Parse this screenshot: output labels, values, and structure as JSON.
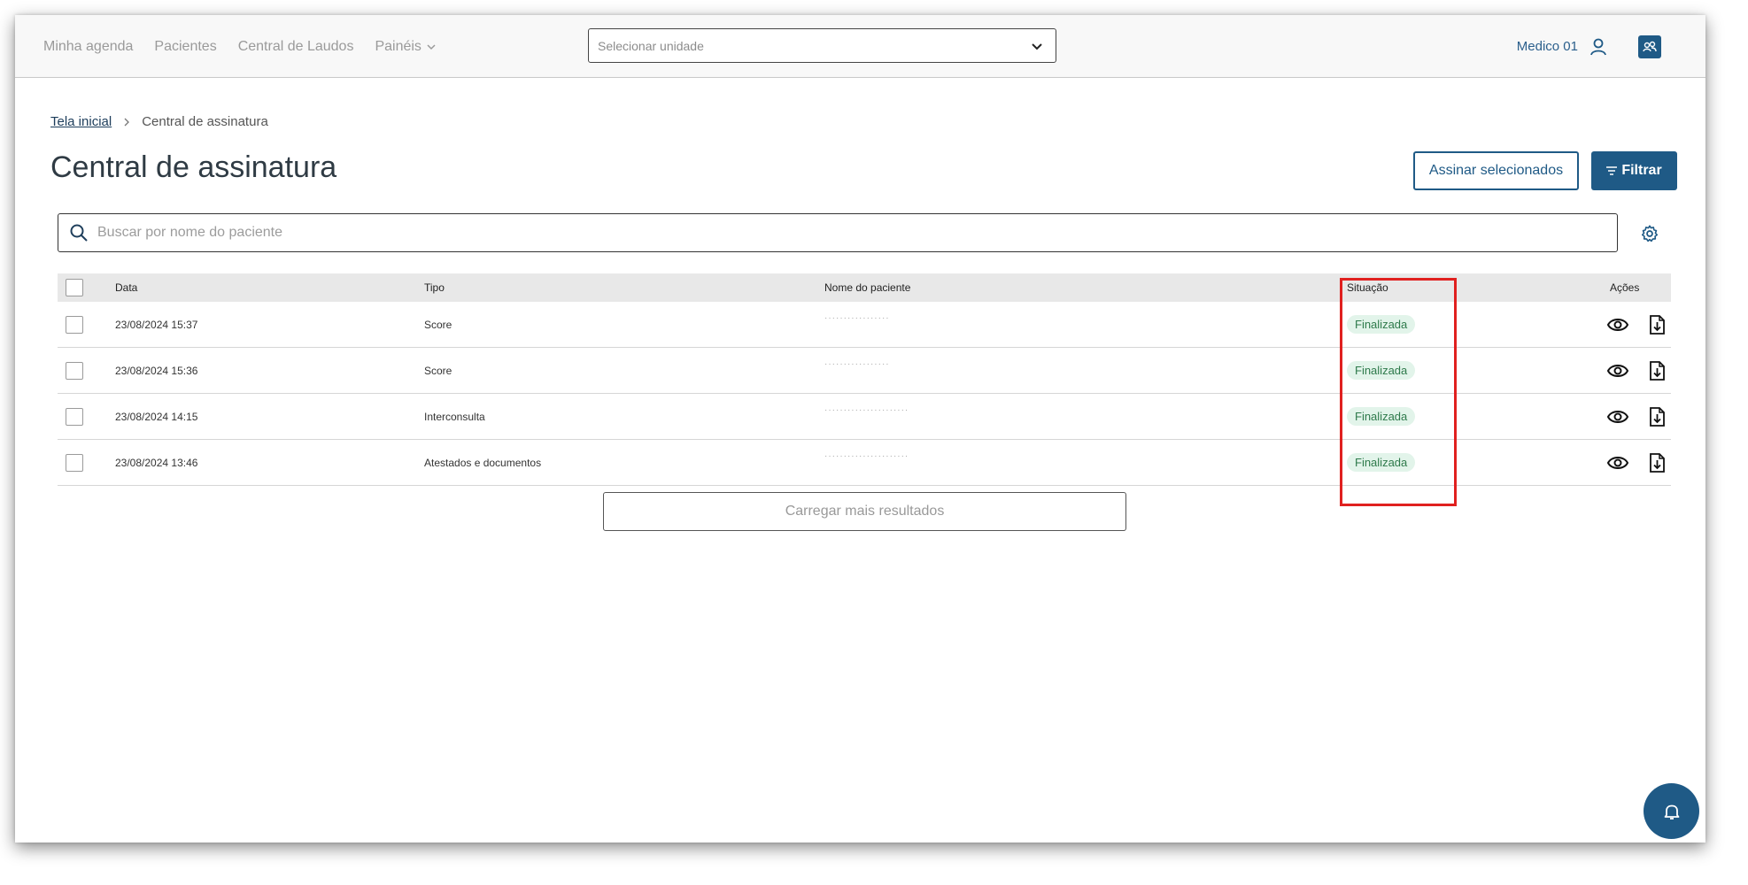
{
  "nav": {
    "items": [
      "Minha agenda",
      "Pacientes",
      "Central de Laudos",
      "Painéis"
    ],
    "unit_placeholder": "Selecionar unidade",
    "user_name": "Medico 01"
  },
  "breadcrumb": {
    "home": "Tela inicial",
    "current": "Central de assinatura"
  },
  "page": {
    "title": "Central de assinatura",
    "sign_selected_label": "Assinar selecionados",
    "filter_label": "Filtrar",
    "search_placeholder": "Buscar por nome do paciente",
    "load_more_label": "Carregar mais resultados"
  },
  "table": {
    "headers": {
      "date": "Data",
      "type": "Tipo",
      "name": "Nome do paciente",
      "status": "Situação",
      "actions": "Ações"
    },
    "rows": [
      {
        "date": "23/08/2024 15:37",
        "type": "Score",
        "name": "·················",
        "status": "Finalizada"
      },
      {
        "date": "23/08/2024 15:36",
        "type": "Score",
        "name": "·················",
        "status": "Finalizada"
      },
      {
        "date": "23/08/2024 14:15",
        "type": "Interconsulta",
        "name": "······················",
        "status": "Finalizada"
      },
      {
        "date": "23/08/2024 13:46",
        "type": "Atestados e documentos",
        "name": "······················",
        "status": "Finalizada"
      }
    ]
  },
  "colors": {
    "primary": "#1f5a86",
    "highlight": "#e0201f",
    "badge_bg": "#e2f4ea",
    "badge_text": "#2e7a4b"
  },
  "icons": [
    "chevron-down-icon",
    "user-icon",
    "profile-icon",
    "search-icon",
    "gear-icon",
    "filter-icon",
    "eye-icon",
    "download-document-icon",
    "bell-icon"
  ]
}
